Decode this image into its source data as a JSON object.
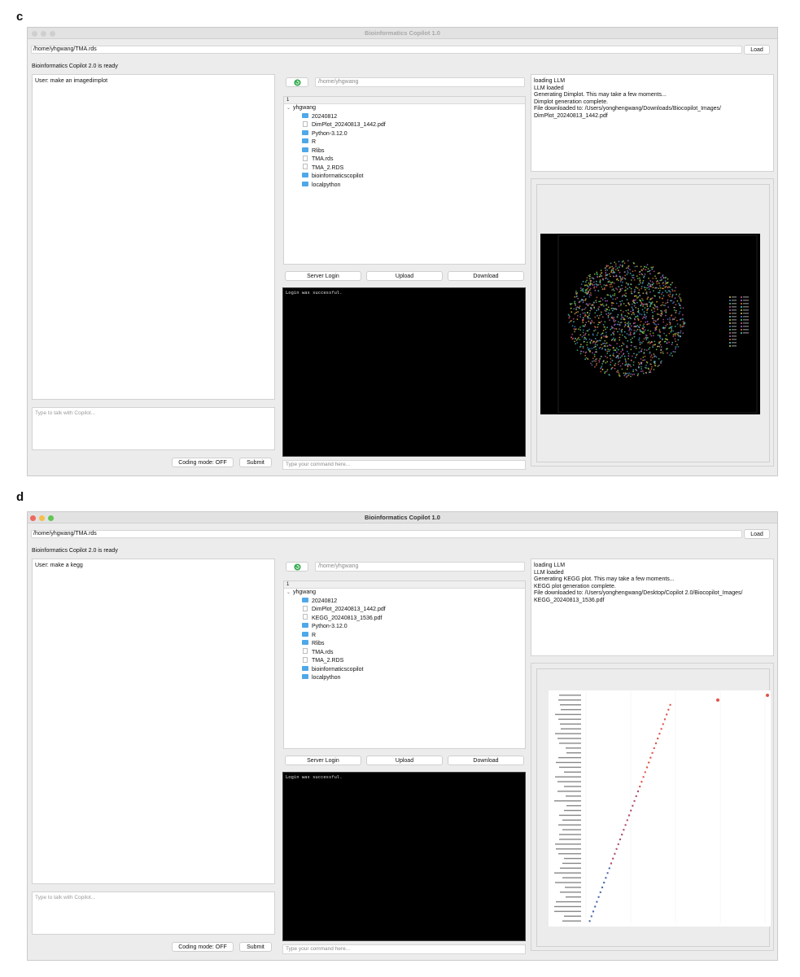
{
  "panels": [
    {
      "label": "c",
      "window_title": "Bioinformatics Copilot 1.0",
      "file_path": "/home/yhgwang/TMA.rds",
      "load_label": "Load",
      "status": "Bioinformatics Copilot 2.0 is ready",
      "chat_message": "User: make an imagedimplot",
      "chat_placeholder": "Type to talk with Copilot...",
      "coding_mode_label": "Coding mode: OFF",
      "submit_label": "Submit",
      "dir_path": "/home/yhgwang",
      "tree_header": "1",
      "tree_root": "yhgwang",
      "tree_items": [
        {
          "name": "20240812",
          "kind": "folder"
        },
        {
          "name": "DimPlot_20240813_1442.pdf",
          "kind": "file"
        },
        {
          "name": "Python-3.12.0",
          "kind": "folder"
        },
        {
          "name": "R",
          "kind": "folder"
        },
        {
          "name": "Rlibs",
          "kind": "folder"
        },
        {
          "name": "TMA.rds",
          "kind": "file"
        },
        {
          "name": "TMA_2.RDS",
          "kind": "file"
        },
        {
          "name": "bioinformaticscopilot",
          "kind": "folder"
        },
        {
          "name": "localpython",
          "kind": "folder"
        }
      ],
      "server_login_label": "Server Login",
      "upload_label": "Upload",
      "download_label": "Download",
      "terminal_text": "Login was successful.",
      "command_placeholder": "Type your command here...",
      "log_lines": [
        "loading LLM",
        "LLM loaded",
        "Generating Dimplot. This may take a few moments...",
        "Dimplot generation complete.",
        "File downloaded to: /Users/yonghengwang/Downloads/Biocopilot_Images/",
        "DimPlot_20240813_1442.pdf"
      ]
    },
    {
      "label": "d",
      "window_title": "Bioinformatics Copilot 1.0",
      "file_path": "/home/yhgwang/TMA.rds",
      "load_label": "Load",
      "status": "Bioinformatics Copilot 2.0 is ready",
      "chat_message": "User: make a kegg",
      "chat_placeholder": "Type to talk with Copilot...",
      "coding_mode_label": "Coding mode: OFF",
      "submit_label": "Submit",
      "dir_path": "/home/yhgwang",
      "tree_header": "1",
      "tree_root": "yhgwang",
      "tree_items": [
        {
          "name": "20240812",
          "kind": "folder"
        },
        {
          "name": "DimPlot_20240813_1442.pdf",
          "kind": "file"
        },
        {
          "name": "KEGG_20240813_1536.pdf",
          "kind": "file"
        },
        {
          "name": "Python-3.12.0",
          "kind": "folder"
        },
        {
          "name": "R",
          "kind": "folder"
        },
        {
          "name": "Rlibs",
          "kind": "folder"
        },
        {
          "name": "TMA.rds",
          "kind": "file"
        },
        {
          "name": "TMA_2.RDS",
          "kind": "file"
        },
        {
          "name": "bioinformaticscopilot",
          "kind": "folder"
        },
        {
          "name": "localpython",
          "kind": "folder"
        }
      ],
      "server_login_label": "Server Login",
      "upload_label": "Upload",
      "download_label": "Download",
      "terminal_text": "Login was successful.",
      "command_placeholder": "Type your command here...",
      "log_lines": [
        "loading LLM",
        "LLM loaded",
        "Generating KEGG plot. This may take a few moments...",
        "KEGG plot generation complete.",
        "File downloaded to: /Users/yonghengwang/Desktop/Copilot 2.0/Biocopilot_Images/",
        "KEGG_20240813_1536.pdf"
      ]
    }
  ],
  "colors": {
    "folder": "#4fa8e8",
    "window_bg": "#ececec",
    "terminal_bg": "#000000",
    "refresh_green": "#2ea84a",
    "kegg_point": "#e0534a",
    "dimplot_clusters": [
      "#e8c64a",
      "#4a8fd8",
      "#4fcf8a",
      "#d85a9a",
      "#b86fe0",
      "#e07a3a",
      "#5ad0d0",
      "#a0d84a"
    ]
  },
  "icons": {
    "refresh": "refresh-icon",
    "folder": "folder-icon",
    "file": "file-icon",
    "chevron": "chevron-down-icon"
  }
}
